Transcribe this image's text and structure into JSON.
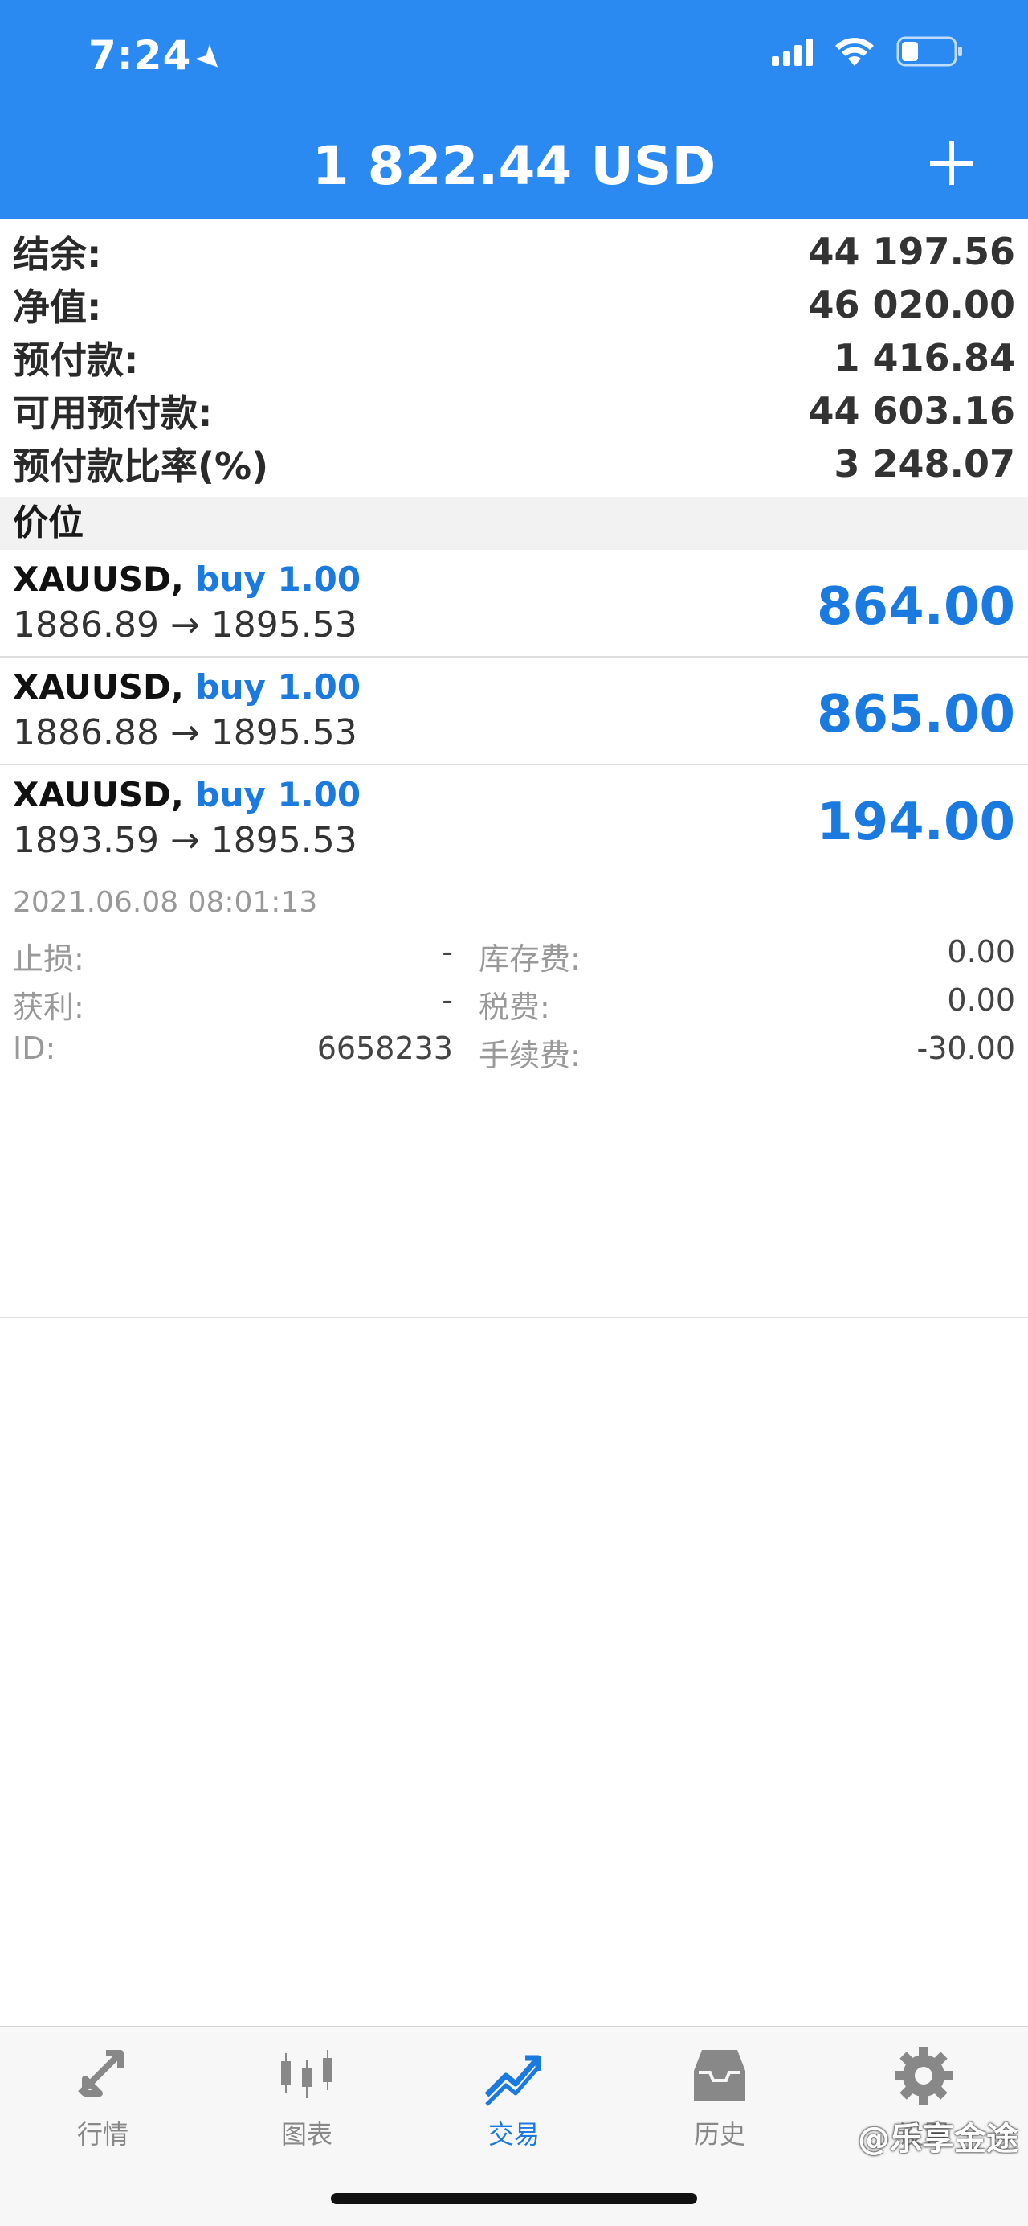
{
  "status_bar": {
    "time": "7:24"
  },
  "header": {
    "title": "1 822.44 USD"
  },
  "summary": [
    {
      "label": "结余:",
      "value": "44 197.56"
    },
    {
      "label": "净值:",
      "value": "46 020.00"
    },
    {
      "label": "预付款:",
      "value": "1 416.84"
    },
    {
      "label": "可用预付款:",
      "value": "44 603.16"
    },
    {
      "label": "预付款比率(%)",
      "value": "3 248.07"
    }
  ],
  "section": {
    "title": "价位"
  },
  "positions": [
    {
      "symbol": "XAUUSD,",
      "direction": "buy 1.00",
      "prices": "1886.89 → 1895.53",
      "profit": "864.00"
    },
    {
      "symbol": "XAUUSD,",
      "direction": "buy 1.00",
      "prices": "1886.88 → 1895.53",
      "profit": "865.00"
    },
    {
      "symbol": "XAUUSD,",
      "direction": "buy 1.00",
      "prices": "1893.59 → 1895.53",
      "profit": "194.00"
    }
  ],
  "details": {
    "time": "2021.06.08 08:01:13",
    "stop_loss_label": "止损:",
    "stop_loss_value": "-",
    "swap_label": "库存费:",
    "swap_value": "0.00",
    "take_profit_label": "获利:",
    "take_profit_value": "-",
    "tax_label": "税费:",
    "tax_value": "0.00",
    "id_label": "ID:",
    "id_value": "6658233",
    "commission_label": "手续费:",
    "commission_value": "-30.00"
  },
  "tabs": [
    {
      "label": "行情",
      "icon": "quotes-icon"
    },
    {
      "label": "图表",
      "icon": "chart-icon"
    },
    {
      "label": "交易",
      "icon": "trade-icon",
      "active": true
    },
    {
      "label": "历史",
      "icon": "history-icon"
    },
    {
      "label": "设置",
      "icon": "settings-icon"
    }
  ],
  "watermark": "@乐享金途",
  "colors": {
    "header": "#2b8af2",
    "accent": "#1a7ae0"
  }
}
